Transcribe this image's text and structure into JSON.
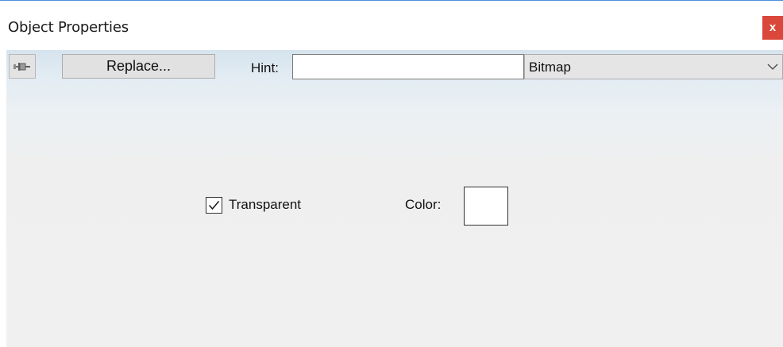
{
  "window": {
    "title": "Object Properties",
    "close_label": "x"
  },
  "toolbar": {
    "pin_icon": "pushpin-icon",
    "replace_label": "Replace...",
    "hint_label": "Hint:",
    "hint_value": "",
    "type_select": {
      "value": "Bitmap",
      "arrow_icon": "chevron-down-icon"
    }
  },
  "options": {
    "transparent_label": "Transparent",
    "transparent_checked": true,
    "color_label": "Color:",
    "color_value": "#ffffff"
  },
  "colors": {
    "close_button": "#d9483b",
    "title_border": "#4a90d9",
    "panel_bg": "#f0f0f0"
  }
}
